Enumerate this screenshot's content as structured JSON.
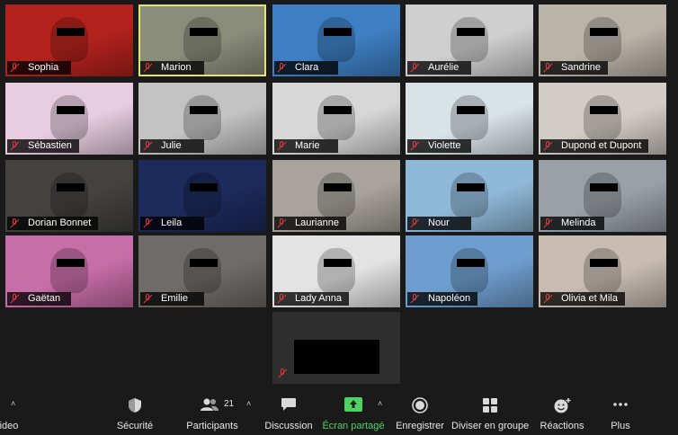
{
  "participants": [
    {
      "name": "Sophia",
      "bg": "#b3221d",
      "active": false
    },
    {
      "name": "Marion",
      "bg": "#8a8d7a",
      "active": true
    },
    {
      "name": "Clara",
      "bg": "#3e7fc3",
      "active": false
    },
    {
      "name": "Aurélie",
      "bg": "#cfcfcf",
      "active": false
    },
    {
      "name": "Sandrine",
      "bg": "#b9b3a8",
      "active": false
    },
    {
      "name": "Sébastien",
      "bg": "#e8cde0",
      "active": false
    },
    {
      "name": "Julie",
      "bg": "#c3c3c3",
      "active": false
    },
    {
      "name": "Marie",
      "bg": "#d7d7d7",
      "active": false
    },
    {
      "name": "Violette",
      "bg": "#d9e2e6",
      "active": false
    },
    {
      "name": "Dupond et Dupont",
      "bg": "#d2ccc6",
      "active": false
    },
    {
      "name": "Dorian Bonnet",
      "bg": "#43423f",
      "active": false
    },
    {
      "name": "Leila",
      "bg": "#1c2a5c",
      "active": false
    },
    {
      "name": "Laurianne",
      "bg": "#a8a39c",
      "active": false
    },
    {
      "name": "Nour",
      "bg": "#8fb9d8",
      "active": false
    },
    {
      "name": "Melinda",
      "bg": "#9aa0a6",
      "active": false
    },
    {
      "name": "Gaëtan",
      "bg": "#c76da7",
      "active": false
    },
    {
      "name": "Emilie",
      "bg": "#6f6b68",
      "active": false
    },
    {
      "name": "Lady Anna",
      "bg": "#e3e3e3",
      "active": false
    },
    {
      "name": "Napoléon",
      "bg": "#6e9ecf",
      "active": false
    },
    {
      "name": "Olivia et Mila",
      "bg": "#c9bdb3",
      "active": false
    }
  ],
  "toolbar": {
    "video_label": "ideo",
    "security_label": "Sécurité",
    "participants_label": "Participants",
    "participants_count": "21",
    "chat_label": "Discussion",
    "share_label": "Écran partagé",
    "record_label": "Enregistrer",
    "breakout_label": "Diviser en groupe",
    "reactions_label": "Réactions",
    "more_label": "Plus"
  },
  "colors": {
    "active_border": "#e6e36a",
    "share_green": "#4fd264",
    "mic_muted": "#e0383e"
  }
}
